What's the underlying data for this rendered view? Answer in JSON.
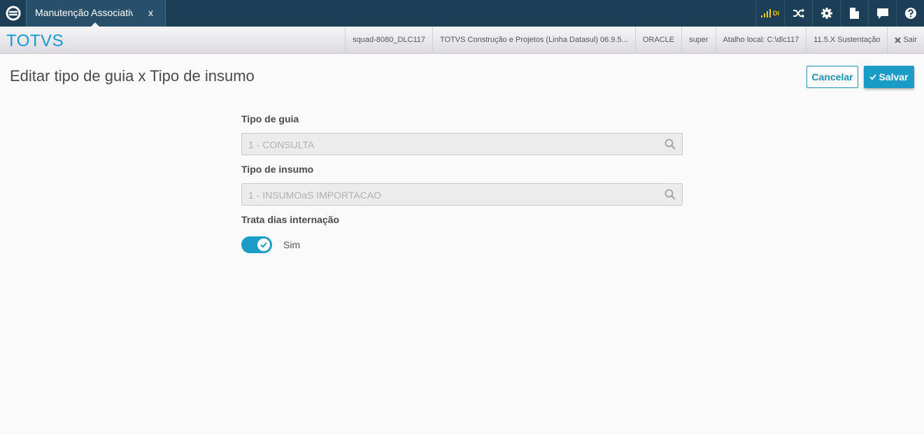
{
  "topbar": {
    "tab_label": "Manutenção Associativa",
    "tab_close": "x",
    "indicator_text": "DI",
    "icons": [
      "totvs-logo-icon",
      "signal-icon",
      "shuffle-icon",
      "gear-icon",
      "document-icon",
      "chat-icon",
      "help-icon"
    ]
  },
  "subbar": {
    "brand": "TOTVS",
    "server": "squad-8080_DLC117",
    "product": "TOTVS Construção e Projetos (Linha Datasul) 06.9.5...",
    "database": "ORACLE",
    "user": "super",
    "shortcut": "Atalho local: C:\\dlc117",
    "version": "11.5.X Sustentação",
    "logout": "Sair"
  },
  "page": {
    "title": "Editar tipo de guia x Tipo de insumo",
    "cancel_label": "Cancelar",
    "save_label": "Salvar"
  },
  "form": {
    "tipo_guia_label": "Tipo de guia",
    "tipo_guia_value": "1 - CONSULTA",
    "tipo_insumo_label": "Tipo de insumo",
    "tipo_insumo_value": "1 - INSUMOaS IMPORTACAO",
    "trata_dias_label": "Trata dias internação",
    "trata_dias_state": "on",
    "trata_dias_text": "Sim"
  },
  "colors": {
    "topbar": "#1c3f57",
    "brand": "#1a97d0",
    "accent": "#1b9cc7",
    "indicator": "#f5c518"
  }
}
